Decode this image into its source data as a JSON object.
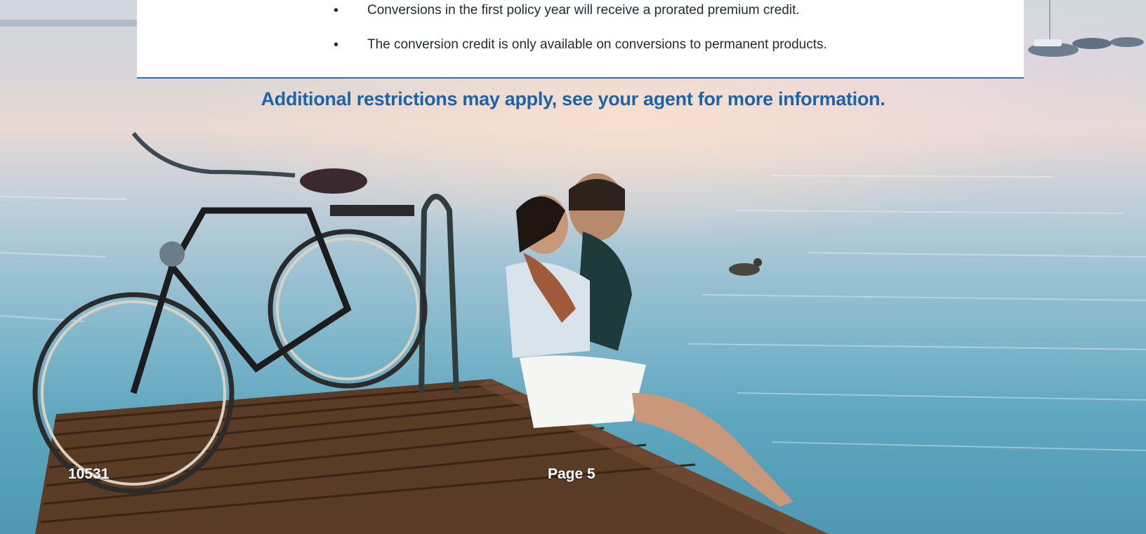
{
  "card": {
    "bullets": [
      "Conversions in the first policy year will receive a prorated premium credit.",
      "The conversion credit is only available on conversions to permanent products."
    ]
  },
  "restrictions_note": "Additional restrictions may apply, see your agent for more information.",
  "footer": {
    "code": "10531",
    "page": "Page 5"
  },
  "colors": {
    "accent_blue": "#1d63a8",
    "card_rule": "#2d6fae"
  },
  "background": {
    "icon": "lake-dock-couple-bicycle-photo"
  }
}
